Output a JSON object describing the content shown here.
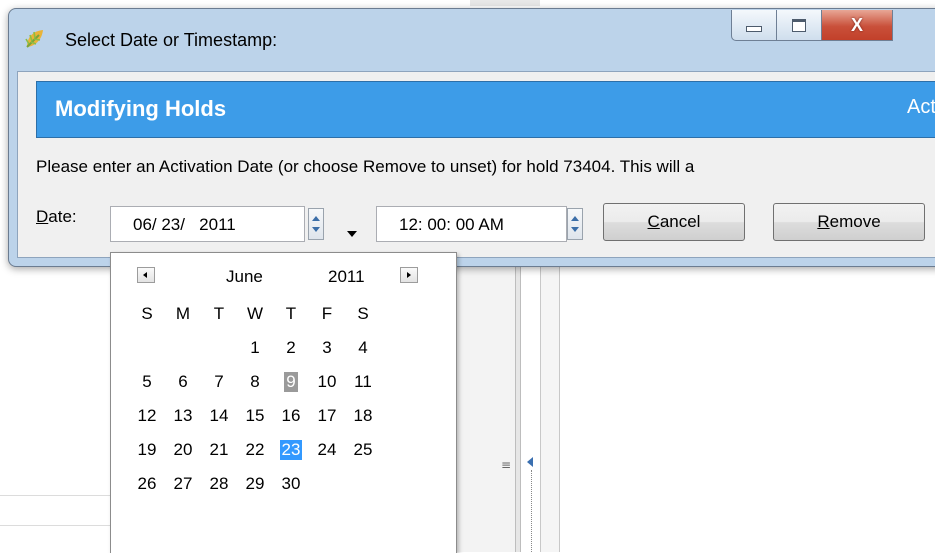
{
  "window": {
    "title": "Select Date or Timestamp:",
    "icon": "app-leaf-icon",
    "controls": {
      "minimize": "minimize-icon",
      "maximize": "maximize-icon",
      "close_label": "X"
    }
  },
  "banner": {
    "title": "Modifying Holds",
    "right_text": "Act",
    "color": "#3d9ce8"
  },
  "message": "Please enter an Activation Date (or choose Remove to unset) for hold 73404. This will a",
  "date_field": {
    "label_key": "D",
    "label_rest": "ate:",
    "value": "06/ 23/   2011"
  },
  "time_field": {
    "value": "12: 00: 00 AM"
  },
  "buttons": {
    "cancel_key": "C",
    "cancel_rest": "ancel",
    "remove_key": "R",
    "remove_rest": "emove"
  },
  "calendar": {
    "month": "June",
    "year": "2011",
    "weekdays": [
      "S",
      "M",
      "T",
      "W",
      "T",
      "F",
      "S"
    ],
    "weeks": [
      [
        "",
        "",
        "",
        "1",
        "2",
        "3",
        "4"
      ],
      [
        "5",
        "6",
        "7",
        "8",
        "9",
        "10",
        "11"
      ],
      [
        "12",
        "13",
        "14",
        "15",
        "16",
        "17",
        "18"
      ],
      [
        "19",
        "20",
        "21",
        "22",
        "23",
        "24",
        "25"
      ],
      [
        "26",
        "27",
        "28",
        "29",
        "30",
        "",
        ""
      ]
    ],
    "today": "9",
    "selected": "23",
    "selected_color": "#3399ff",
    "today_color": "#9a9a9a"
  }
}
